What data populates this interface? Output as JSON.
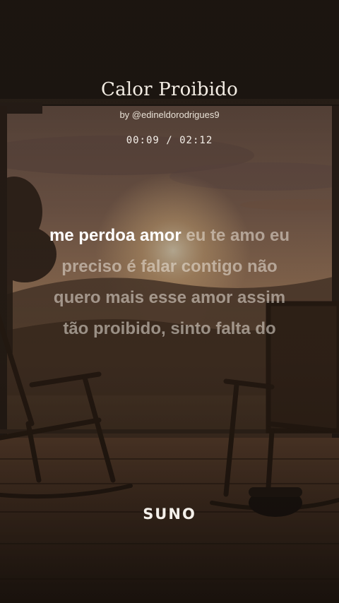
{
  "song": {
    "title": "Calor Proibido",
    "artist": "by @edineldorodrigues9",
    "time": "00:09 / 02:12"
  },
  "lyrics": {
    "active": "me perdoa amor",
    "rest_line1": " eu te amo eu",
    "line2": "preciso é falar contigo não",
    "line3": "quero mais esse amor assim",
    "line4": "tão proibido, sinto falta do"
  },
  "brand": {
    "logo_text": "SUNO"
  },
  "colors": {
    "sky_top": "#3a2a22",
    "sky_glow": "#e6b27a",
    "ground": "#3b2a1e",
    "porch_roof": "#1e1712",
    "text_primary": "#ffffff"
  },
  "icons": [
    "rocking-chair-left",
    "rocking-chair-right",
    "telephone"
  ]
}
